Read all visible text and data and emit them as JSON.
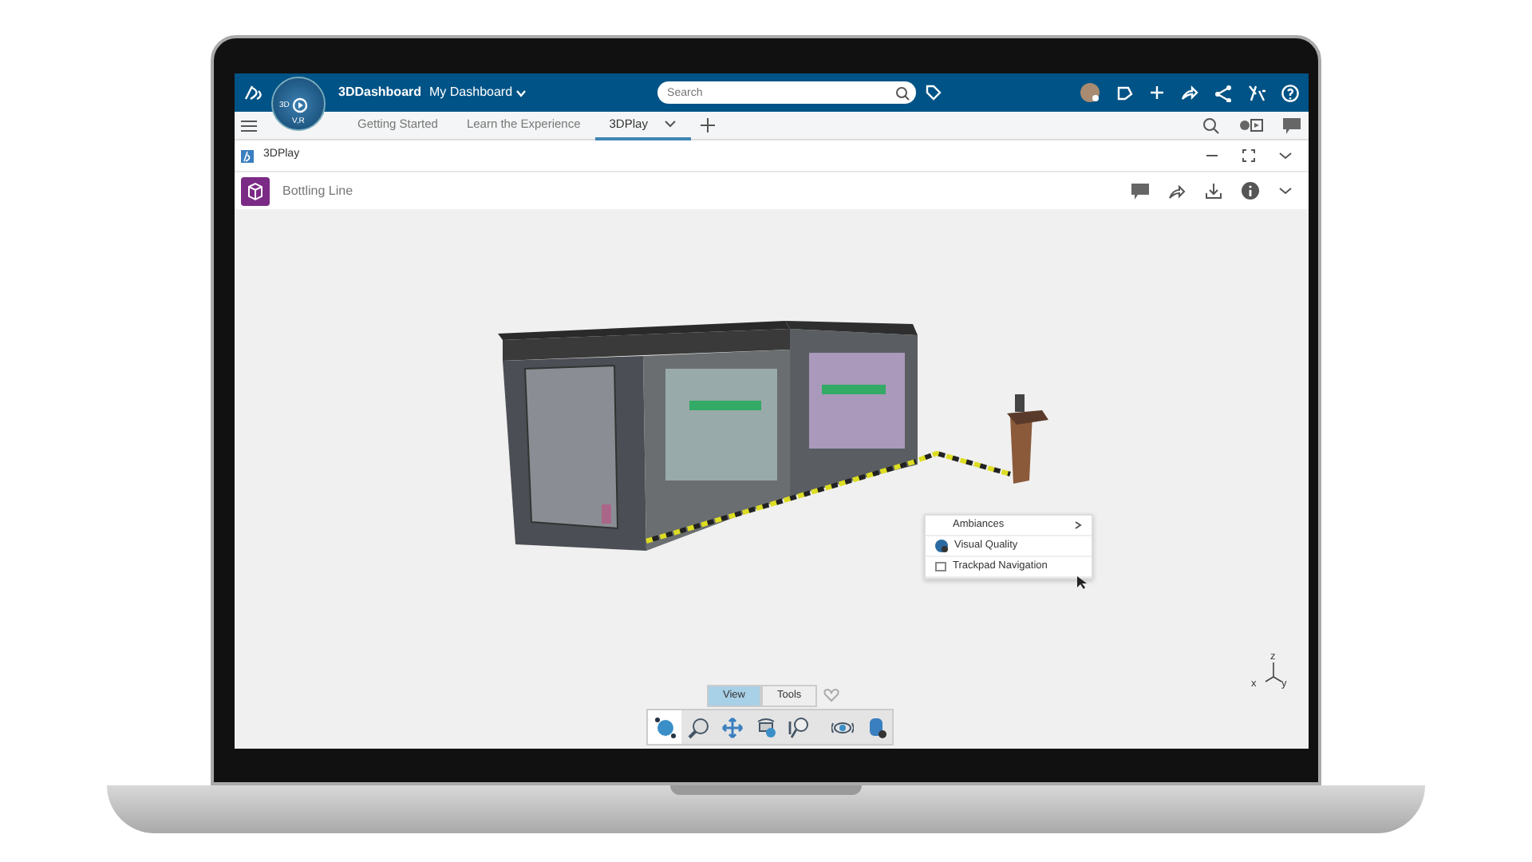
{
  "topbar": {
    "compass_labels": [
      "3D",
      "V,R"
    ],
    "title": "3DDashboard",
    "dashboard": "My Dashboard",
    "search": {
      "placeholder": "Search"
    }
  },
  "tabs": [
    {
      "label": "Getting Started",
      "selected": false
    },
    {
      "label": "Learn the Experience",
      "selected": false
    },
    {
      "label": "3DPlay",
      "selected": true
    }
  ],
  "widget": {
    "title": "3DPlay"
  },
  "app": {
    "title": "Bottling Line"
  },
  "context_menu": [
    {
      "label": "Ambiances",
      "kind": "submenu"
    },
    {
      "label": "Visual Quality",
      "kind": "icon"
    },
    {
      "label": "Trackpad Navigation",
      "kind": "checkbox",
      "checked": false
    }
  ],
  "toolbar": {
    "tabs": [
      {
        "label": "View",
        "selected": true
      },
      {
        "label": "Tools",
        "selected": false
      }
    ]
  },
  "axis": {
    "labels": [
      "z",
      "x",
      "y"
    ]
  }
}
